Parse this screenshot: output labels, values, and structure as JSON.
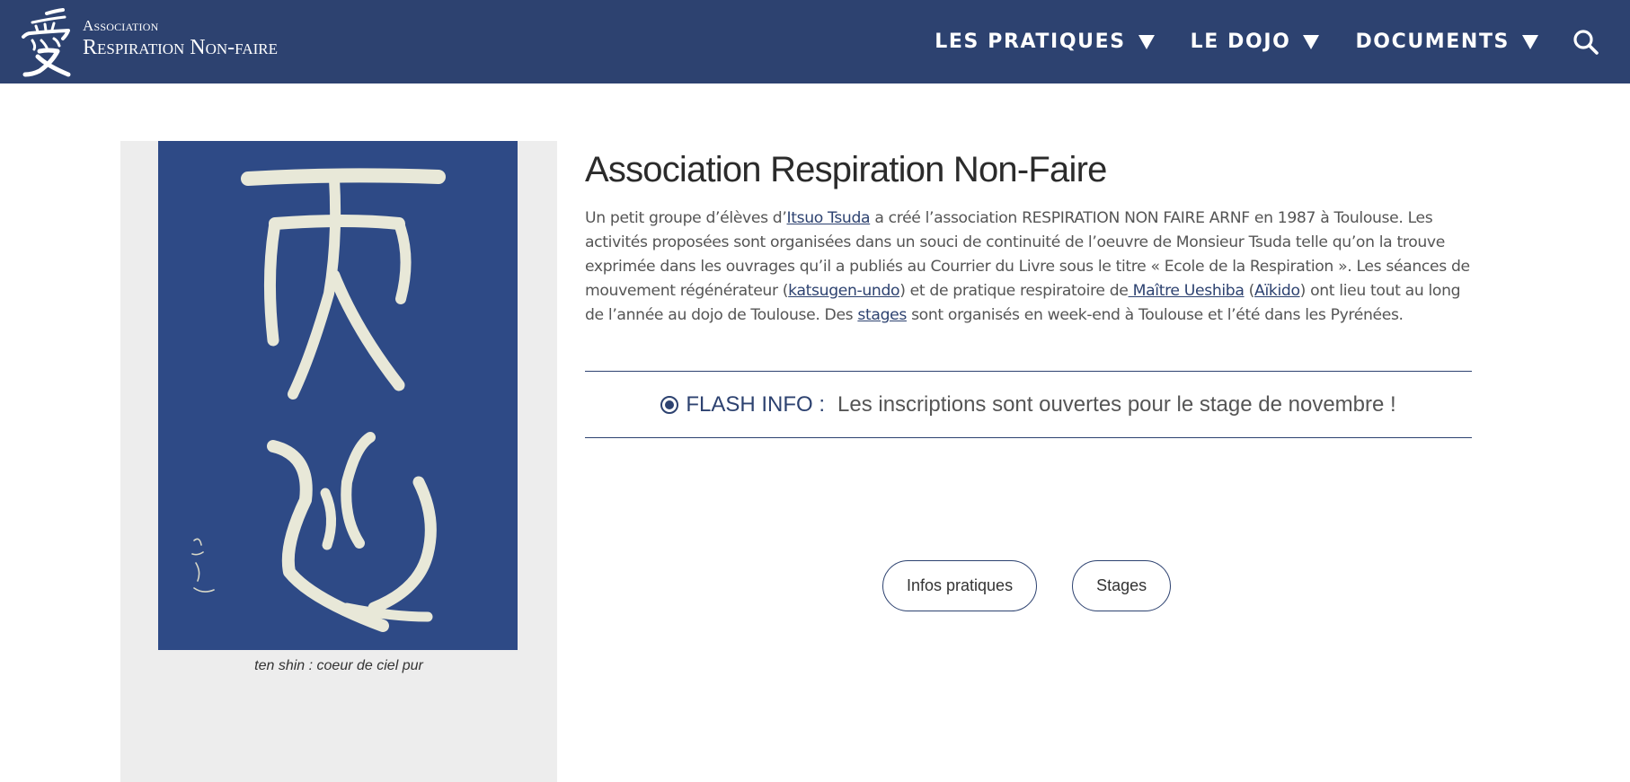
{
  "header": {
    "logo": {
      "icon": "kanji-ai-icon",
      "line1": "Association",
      "line2": "Respiration Non-faire"
    },
    "nav": [
      {
        "label": "LES PRATIQUES"
      },
      {
        "label": "LE DOJO"
      },
      {
        "label": "DOCUMENTS"
      }
    ],
    "search_icon": "search-icon"
  },
  "sidebar": {
    "image_icon": "calligraphy-image",
    "caption": "ten shin : coeur de ciel pur"
  },
  "main": {
    "title": "Association Respiration Non-Faire",
    "intro": {
      "t1": "Un petit groupe d’élèves d’",
      "link1": "Itsuo Tsuda",
      "t2": " a créé l’association RESPIRATION NON FAIRE ARNF en 1987 à Toulouse. Les activités proposées sont organisées dans un souci de continuité de l’oeuvre de Monsieur Tsuda telle qu’on la trouve exprimée dans les ouvrages qu’il a publiés au Courrier du Livre sous le titre « Ecole de la Respiration ». Les séances de mouvement régénérateur (",
      "link2": "katsugen-undo",
      "t3": ") et de pratique respiratoire de",
      "link3": " Maître Ueshiba",
      "t4": " (",
      "link4": "Aïkido",
      "t5": ") ont lieu tout au long de l’année au dojo de Toulouse. Des ",
      "link5": "stages",
      "t6": " sont organisés en week-end à Toulouse et l’été dans les Pyrénées."
    },
    "flash": {
      "label": "FLASH INFO :",
      "text": "Les inscriptions sont ouvertes pour le stage de novembre !"
    },
    "buttons": [
      {
        "label": "Infos pratiques"
      },
      {
        "label": "Stages"
      }
    ]
  },
  "colors": {
    "brand": "#2d4270",
    "calligraphy_bg": "#2e4a86",
    "sidebar_bg": "#ededed"
  }
}
